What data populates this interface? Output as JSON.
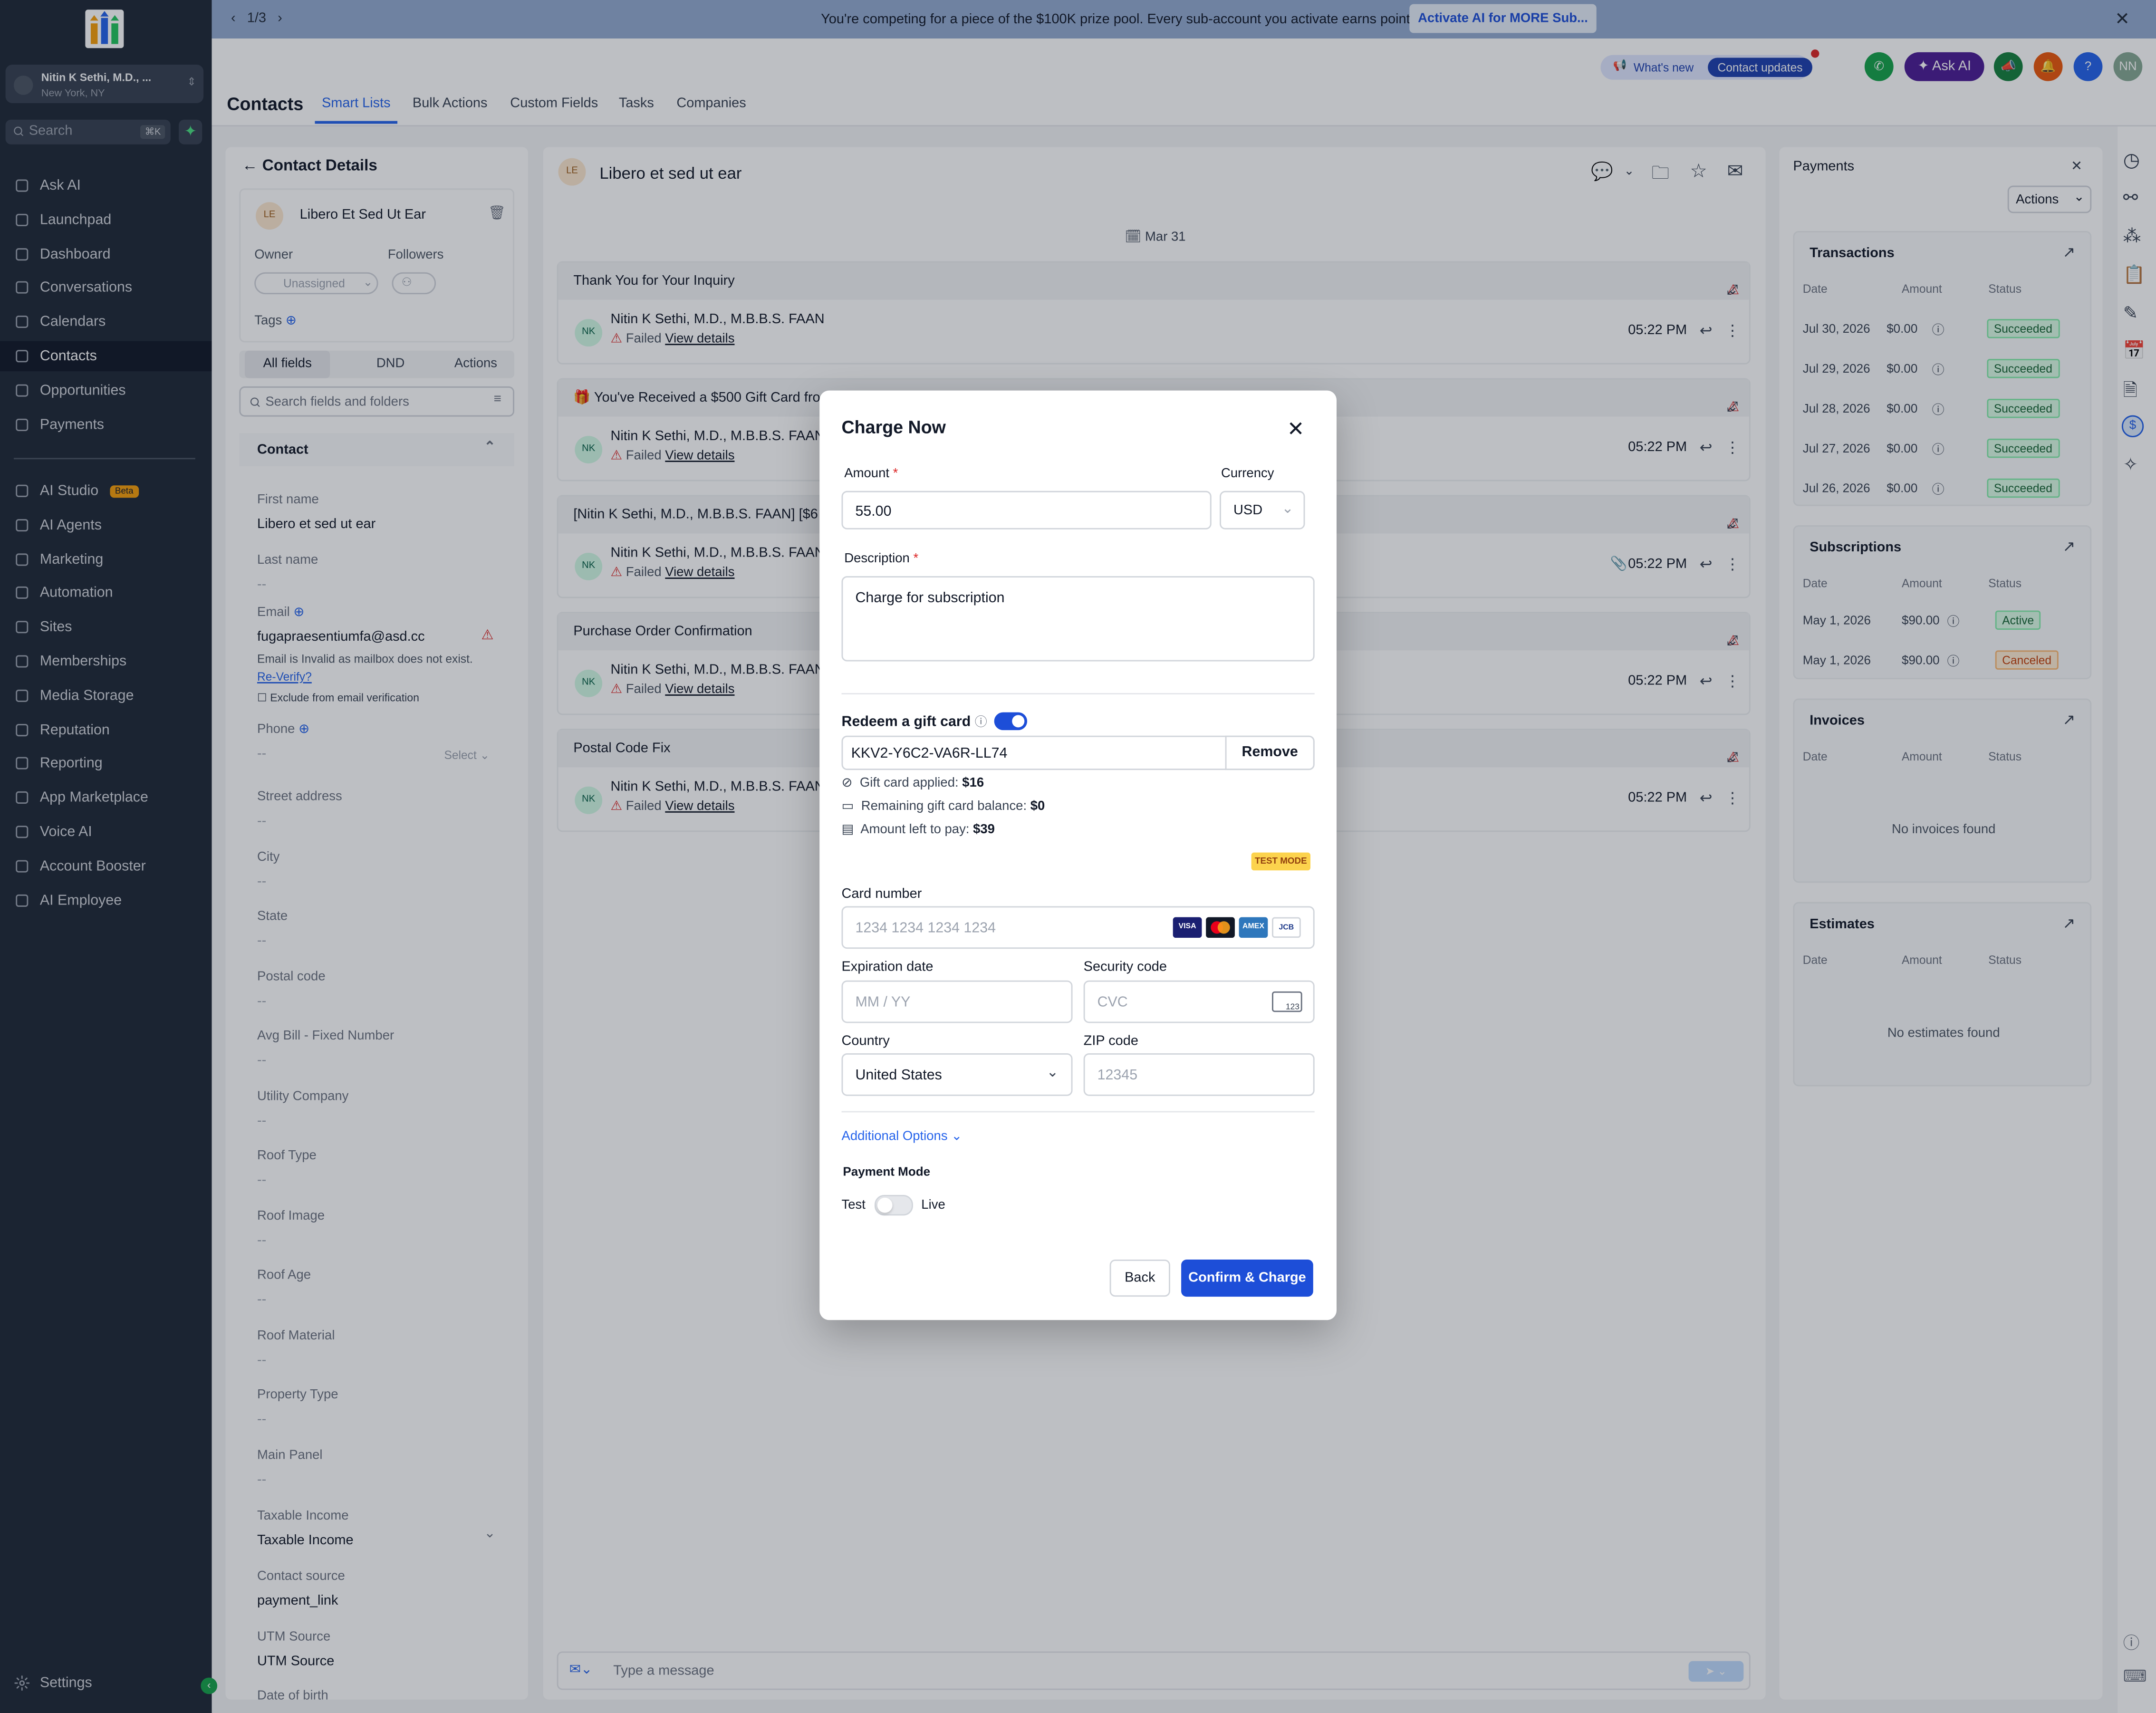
{
  "banner": {
    "pager": "1/3",
    "message": "You're competing for a piece of the $100K prize pool. Every sub-account you activate earns points.",
    "cta": "Activate AI for MORE Sub..."
  },
  "account": {
    "name": "Nitin K Sethi, M.D., ...",
    "location": "New York, NY"
  },
  "sidebar": {
    "search_placeholder": "Search",
    "search_kbd": "⌘K",
    "items": [
      {
        "label": "Ask AI",
        "icon": "sparkle-icon"
      },
      {
        "label": "Launchpad",
        "icon": "rocket-icon"
      },
      {
        "label": "Dashboard",
        "icon": "grid-icon"
      },
      {
        "label": "Conversations",
        "icon": "chat-icon"
      },
      {
        "label": "Calendars",
        "icon": "calendar-icon"
      },
      {
        "label": "Contacts",
        "icon": "contacts-icon",
        "active": true
      },
      {
        "label": "Opportunities",
        "icon": "filter-icon"
      },
      {
        "label": "Payments",
        "icon": "card-icon"
      }
    ],
    "items2": [
      {
        "label": "AI Studio",
        "icon": "atom-icon",
        "badge": "Beta"
      },
      {
        "label": "AI Agents",
        "icon": "agent-icon"
      },
      {
        "label": "Marketing",
        "icon": "send-icon"
      },
      {
        "label": "Automation",
        "icon": "flow-icon"
      },
      {
        "label": "Sites",
        "icon": "globe-icon"
      },
      {
        "label": "Memberships",
        "icon": "member-icon"
      },
      {
        "label": "Media Storage",
        "icon": "folder-icon"
      },
      {
        "label": "Reputation",
        "icon": "star-icon"
      },
      {
        "label": "Reporting",
        "icon": "chart-icon"
      },
      {
        "label": "App Marketplace",
        "icon": "apps-icon"
      },
      {
        "label": "Voice AI",
        "icon": "phone-icon"
      },
      {
        "label": "Account Booster",
        "icon": "booster-icon"
      },
      {
        "label": "AI Employee",
        "icon": "person-icon"
      }
    ],
    "settings": "Settings"
  },
  "header": {
    "title": "Contacts",
    "tabs": [
      "Smart Lists",
      "Bulk Actions",
      "Custom Fields",
      "Tasks",
      "Companies"
    ],
    "whats_new": "What's new",
    "contact_updates": "Contact updates",
    "ask_ai": "Ask AI",
    "user_initials": "NN"
  },
  "contact": {
    "heading": "Contact Details",
    "initials": "LE",
    "name": "Libero Et Sed Ut Ear",
    "owner_label": "Owner",
    "owner_value": "Unassigned",
    "followers_label": "Followers",
    "tags_label": "Tags",
    "segments": [
      "All fields",
      "DND",
      "Actions"
    ],
    "search_placeholder": "Search fields and folders",
    "section": "Contact",
    "email_label": "Email",
    "email_value": "fugapraesentiumfa@asd.cc",
    "email_warning": "Email is Invalid as mailbox does not exist.",
    "reverify": "Re-Verify?",
    "exclude": "Exclude from email verification",
    "phone_label": "Phone",
    "phone_select": "Select",
    "fields": [
      {
        "label": "First name",
        "value": "Libero et sed ut ear"
      },
      {
        "label": "Last name",
        "value": "--"
      },
      {
        "label": "Street address",
        "value": "--"
      },
      {
        "label": "City",
        "value": "--"
      },
      {
        "label": "State",
        "value": "--"
      },
      {
        "label": "Postal code",
        "value": "--"
      },
      {
        "label": "Avg Bill - Fixed Number",
        "value": "--"
      },
      {
        "label": "Utility Company",
        "value": "--"
      },
      {
        "label": "Roof Type",
        "value": "--"
      },
      {
        "label": "Roof Image",
        "value": "--"
      },
      {
        "label": "Roof Age",
        "value": "--"
      },
      {
        "label": "Roof Material",
        "value": "--"
      },
      {
        "label": "Property Type",
        "value": "--"
      },
      {
        "label": "Main Panel",
        "value": "--"
      },
      {
        "label": "Taxable Income",
        "value": "Taxable Income"
      },
      {
        "label": "Contact source",
        "value": "payment_link"
      },
      {
        "label": "UTM Source",
        "value": "UTM Source"
      },
      {
        "label": "Date of birth",
        "value": ""
      }
    ]
  },
  "conversation": {
    "initials": "LE",
    "title": "Libero et sed ut ear",
    "date": "Mar 31",
    "items": [
      {
        "subject": "Thank You for Your Inquiry",
        "sender": "Nitin K Sethi, M.D., M.B.B.S. FAAN",
        "time": "05:22 PM"
      },
      {
        "subject": "🎁 You've Received a $500 Gift Card fro",
        "sender": "Nitin K Sethi, M.D., M.B.B.S. FAAN",
        "time": "05:22 PM"
      },
      {
        "subject": "[Nitin K Sethi, M.D., M.B.B.S. FAAN] [$6",
        "sender": "Nitin K Sethi, M.D., M.B.B.S. FAAN",
        "time": "05:22 PM"
      },
      {
        "subject": "Purchase Order Confirmation",
        "sender": "Nitin K Sethi, M.D., M.B.B.S. FAAN",
        "time": "05:22 PM"
      },
      {
        "subject": "Postal Code Fix",
        "sender": "Nitin K Sethi, M.D., M.B.B.S. FAAN",
        "time": "05:22 PM"
      }
    ],
    "sender_initials": "NK",
    "failed": "Failed",
    "view_details": "View details",
    "message_placeholder": "Type a message"
  },
  "payments": {
    "title": "Payments",
    "actions": "Actions",
    "transactions": {
      "title": "Transactions",
      "cols": [
        "Date",
        "Amount",
        "Status"
      ],
      "rows": [
        {
          "date": "Jul 30, 2026",
          "amount": "$0.00",
          "status": "Succeeded"
        },
        {
          "date": "Jul 29, 2026",
          "amount": "$0.00",
          "status": "Succeeded"
        },
        {
          "date": "Jul 28, 2026",
          "amount": "$0.00",
          "status": "Succeeded"
        },
        {
          "date": "Jul 27, 2026",
          "amount": "$0.00",
          "status": "Succeeded"
        },
        {
          "date": "Jul 26, 2026",
          "amount": "$0.00",
          "status": "Succeeded"
        }
      ]
    },
    "subscriptions": {
      "title": "Subscriptions",
      "cols": [
        "Date",
        "Amount",
        "Status"
      ],
      "rows": [
        {
          "date": "May 1, 2026",
          "amount": "$90.00",
          "status": "Active"
        },
        {
          "date": "May 1, 2026",
          "amount": "$90.00",
          "status": "Canceled"
        }
      ]
    },
    "invoices": {
      "title": "Invoices",
      "cols": [
        "Date",
        "Amount",
        "Status"
      ],
      "empty": "No invoices found"
    },
    "estimates": {
      "title": "Estimates",
      "cols": [
        "Date",
        "Amount",
        "Status"
      ],
      "empty": "No estimates found"
    }
  },
  "modal": {
    "title": "Charge Now",
    "amount_label": "Amount",
    "amount_value": "55.00",
    "currency_label": "Currency",
    "currency_value": "USD",
    "description_label": "Description",
    "description_value": "Charge for subscription",
    "gift_label": "Redeem a gift card",
    "gift_enabled": true,
    "gift_code": "KKV2-Y6C2-VA6R-LL74",
    "remove": "Remove",
    "applied_label": "Gift card applied:",
    "applied_value": "$16",
    "balance_label": "Remaining gift card balance:",
    "balance_value": "$0",
    "left_label": "Amount left to pay:",
    "left_value": "$39",
    "test_mode": "TEST MODE",
    "card_label": "Card number",
    "card_placeholder": "1234 1234 1234 1234",
    "brands": [
      "VISA",
      "MC",
      "AMEX",
      "JCB"
    ],
    "exp_label": "Expiration date",
    "exp_placeholder": "MM / YY",
    "cvc_label": "Security code",
    "cvc_placeholder": "CVC",
    "cvc_hint": "123",
    "country_label": "Country",
    "country_value": "United States",
    "zip_label": "ZIP code",
    "zip_placeholder": "12345",
    "additional": "Additional Options",
    "mode_label": "Payment Mode",
    "mode_test": "Test",
    "mode_live": "Live",
    "live_enabled": false,
    "back": "Back",
    "confirm": "Confirm & Charge"
  },
  "colors": {
    "primary": "#1d4ed8",
    "sidebar": "#1f2937",
    "success": "#166534",
    "danger": "#dc2626"
  }
}
